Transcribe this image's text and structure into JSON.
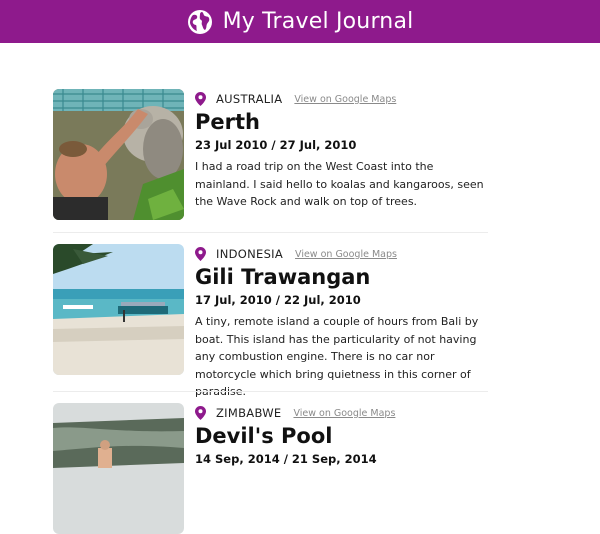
{
  "header": {
    "title": "My Travel Journal",
    "icon": "globe-icon"
  },
  "link_label": "View on Google Maps",
  "colors": {
    "brand": "#8e1a8c",
    "pin": "#8e1a8c"
  },
  "entries": [
    {
      "country": "AUSTRALIA",
      "place": "Perth",
      "dates": "23 Jul 2010 / 27 Jul, 2010",
      "description": "I had a road trip on the West Coast into the mainland. I said hello to koalas and kangaroos, seen the Wave Rock and walk on top of trees."
    },
    {
      "country": "INDONESIA",
      "place": "Gili Trawangan",
      "dates": "17 Jul, 2010 / 22 Jul, 2010",
      "description": "A tiny, remote island a couple of hours from Bali by boat. This island has the particularity of not having any combustion engine. There is no car nor motorcycle which bring quietness in this corner of paradise."
    },
    {
      "country": "ZIMBABWE",
      "place": "Devil's Pool",
      "dates": "14 Sep, 2014 / 21 Sep, 2014"
    }
  ]
}
